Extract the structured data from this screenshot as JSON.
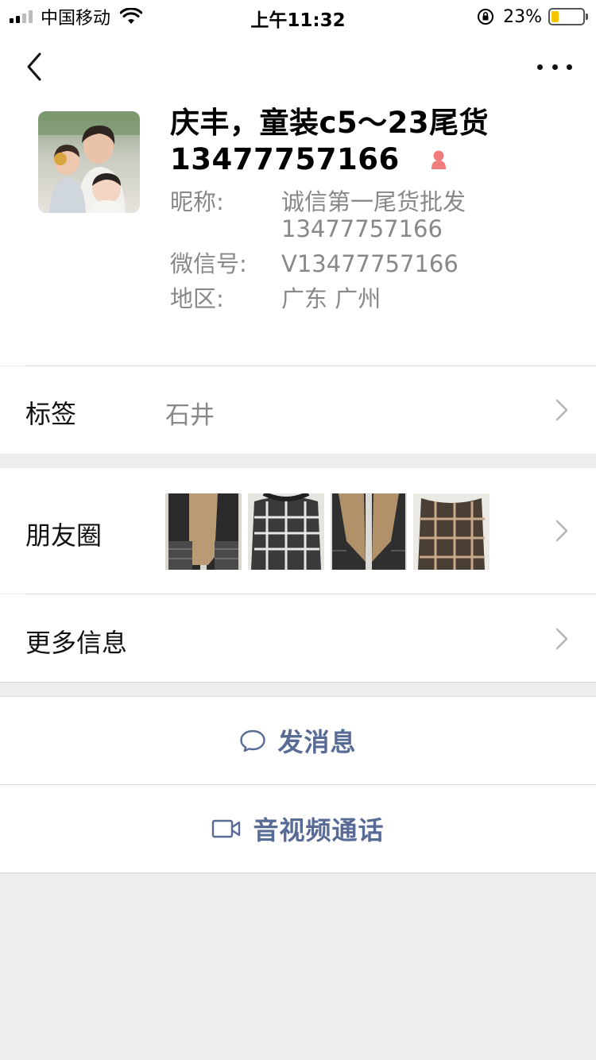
{
  "status_bar": {
    "carrier": "中国移动",
    "time": "上午11:32",
    "battery_percent": "23%",
    "battery_level": 0.23,
    "battery_color": "#f5c400"
  },
  "nav": {
    "back_icon": "chevron-left-icon",
    "more_icon": "ellipsis-icon"
  },
  "profile": {
    "name_line1": "庆丰，童装c5～23尾货",
    "name_line2": "13477757166",
    "gender_icon": "female-icon",
    "nickname_label": "昵称:",
    "nickname_value_1": "诚信第一尾货批发",
    "nickname_value_2": "13477757166",
    "wechat_id_label": "微信号:",
    "wechat_id_value": "V13477757166",
    "region_label": "地区:",
    "region_value": "广东 广州"
  },
  "tags": {
    "label": "标签",
    "value": "石井"
  },
  "moments": {
    "label": "朋友圈",
    "thumbnail_count": 4
  },
  "more_info": {
    "label": "更多信息"
  },
  "actions": {
    "message_label": "发消息",
    "message_icon": "chat-bubble-icon",
    "call_label": "音视频通话",
    "call_icon": "video-camera-icon",
    "accent_color": "#576b95"
  }
}
